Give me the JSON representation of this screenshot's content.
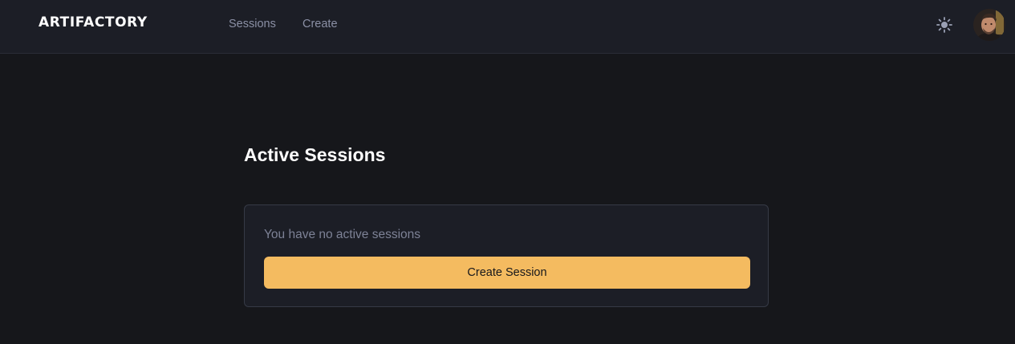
{
  "header": {
    "logo": "ARTIFACTORY",
    "nav": [
      {
        "label": "Sessions"
      },
      {
        "label": "Create"
      }
    ],
    "theme_toggle_icon": "sun-icon",
    "avatar_icon": "user-avatar"
  },
  "main": {
    "title": "Active Sessions",
    "empty_state": {
      "message": "You have no active sessions",
      "button_label": "Create Session"
    }
  },
  "colors": {
    "background": "#16171b",
    "header_bg": "#1c1e26",
    "card_bg": "#1c1e26",
    "accent": "#f4bb60",
    "muted_text": "#7d8296",
    "nav_text": "#8b90a5"
  }
}
